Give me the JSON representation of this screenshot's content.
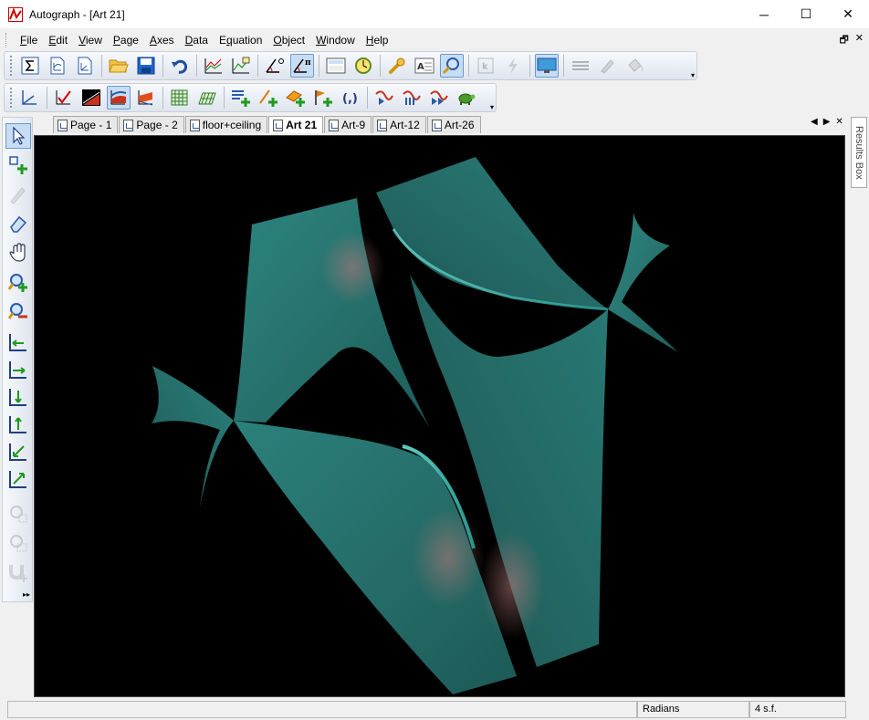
{
  "window": {
    "title": "Autograph - [Art 21]",
    "minimize_glyph": "─",
    "maximize_glyph": "☐",
    "close_glyph": "✕"
  },
  "menubar": {
    "items": [
      {
        "label": "File",
        "key": "F"
      },
      {
        "label": "Edit",
        "key": "E"
      },
      {
        "label": "View",
        "key": "V"
      },
      {
        "label": "Page",
        "key": "P"
      },
      {
        "label": "Axes",
        "key": "A"
      },
      {
        "label": "Data",
        "key": "D"
      },
      {
        "label": "Equation",
        "key": "q"
      },
      {
        "label": "Object",
        "key": "O"
      },
      {
        "label": "Window",
        "key": "W"
      },
      {
        "label": "Help",
        "key": "H"
      }
    ],
    "mdi_restore": "🗗",
    "mdi_close": "✕"
  },
  "toolbar1": {
    "icons": [
      "sigma-icon",
      "new-2d-page-icon",
      "new-3d-page-icon",
      "open-folder-icon",
      "save-icon",
      "undo-icon",
      "graph-stats-icon",
      "graph-data-icon",
      "angle-degrees-icon",
      "angle-radians-icon",
      "calculator-icon",
      "animation-controller-icon",
      "wrench-icon",
      "text-box-icon",
      "zoom-magnifier-icon",
      "slow-plot-icon",
      "lightning-icon",
      "display-icon",
      "line-style-icon",
      "pen-icon",
      "fill-bucket-icon"
    ]
  },
  "toolbar2": {
    "icons": [
      "axes-icon",
      "tick-graph-icon",
      "color-fill-1-icon",
      "color-fill-2-icon",
      "color-fill-3-icon",
      "grid-icon",
      "3d-grid-icon",
      "add-equation-icon",
      "add-line-icon",
      "add-plane-icon",
      "add-flag-icon",
      "brackets-icon",
      "arrow-1-icon",
      "arrow-2-icon",
      "arrow-3-icon",
      "turtle-icon"
    ]
  },
  "tabs": [
    {
      "label": "Page - 1",
      "active": false
    },
    {
      "label": "Page - 2",
      "active": false
    },
    {
      "label": "floor+ceiling",
      "active": false
    },
    {
      "label": "Art 21",
      "active": true
    },
    {
      "label": "Art-9",
      "active": false
    },
    {
      "label": "Art-12",
      "active": false
    },
    {
      "label": "Art-26",
      "active": false
    }
  ],
  "results_box": "Results Box",
  "statusbar": {
    "angle_mode": "Radians",
    "precision": "4 s.f."
  },
  "colors": {
    "surface": "#2b7d78",
    "background": "#000000"
  }
}
